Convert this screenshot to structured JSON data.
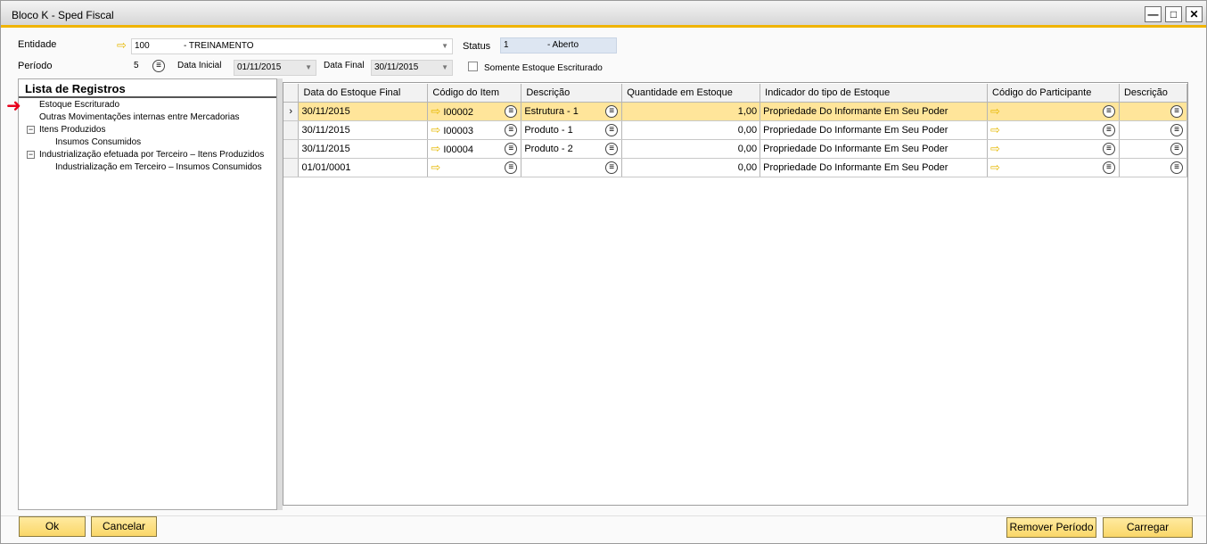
{
  "window": {
    "title": "Bloco K - Sped Fiscal"
  },
  "window_controls": {
    "minimize": "—",
    "maximize": "□",
    "close": "✕"
  },
  "form": {
    "entidade_label": "Entidade",
    "entidade_code": "100",
    "entidade_name": "- TREINAMENTO",
    "status_label": "Status",
    "status_code": "1",
    "status_name": "- Aberto",
    "periodo_label": "Período",
    "periodo_value": "5",
    "data_inicial_label": "Data Inicial",
    "data_inicial_value": "01/11/2015",
    "data_final_label": "Data Final",
    "data_final_value": "30/11/2015",
    "somente_label": "Somente Estoque Escriturado"
  },
  "tree": {
    "title": "Lista de Registros",
    "items": [
      {
        "label": "Estoque Escriturado"
      },
      {
        "label": "Outras Movimentações internas entre Mercadorias"
      },
      {
        "label": "Itens Produzidos"
      },
      {
        "label": "Insumos Consumidos"
      },
      {
        "label": "Industrialização efetuada por Terceiro – Itens Produzidos"
      },
      {
        "label": "Industrialização em Terceiro – Insumos Consumidos"
      }
    ]
  },
  "grid": {
    "columns": [
      "Data do Estoque Final",
      "Código do Item",
      "Descrição",
      "Quantidade em Estoque",
      "Indicador do tipo de Estoque",
      "Código do Participante",
      "Descrição"
    ],
    "rows": [
      {
        "date": "30/11/2015",
        "item": "I00002",
        "desc": "Estrutura - 1",
        "qty": "1,00",
        "indicator": "Propriedade Do Informante Em Seu Poder",
        "participant": "",
        "desc2": ""
      },
      {
        "date": "30/11/2015",
        "item": "I00003",
        "desc": "Produto - 1",
        "qty": "0,00",
        "indicator": "Propriedade Do Informante Em Seu Poder",
        "participant": "",
        "desc2": ""
      },
      {
        "date": "30/11/2015",
        "item": "I00004",
        "desc": "Produto - 2",
        "qty": "0,00",
        "indicator": "Propriedade Do Informante Em Seu Poder",
        "participant": "",
        "desc2": ""
      },
      {
        "date": "01/01/0001",
        "item": "",
        "desc": "",
        "qty": "0,00",
        "indicator": "Propriedade Do Informante Em Seu Poder",
        "participant": "",
        "desc2": ""
      }
    ]
  },
  "buttons": {
    "ok": "Ok",
    "cancelar": "Cancelar",
    "remover": "Remover Período",
    "carregar": "Carregar"
  },
  "icons": {
    "link_arrow": "⇨",
    "list_button": "≡",
    "row_selector": "›",
    "red_marker": "➜",
    "tree_expand": "−"
  },
  "colors": {
    "accent": "#f0b400",
    "selected_row": "#ffe59a",
    "button": "#fad768",
    "marker": "#e8001c"
  }
}
